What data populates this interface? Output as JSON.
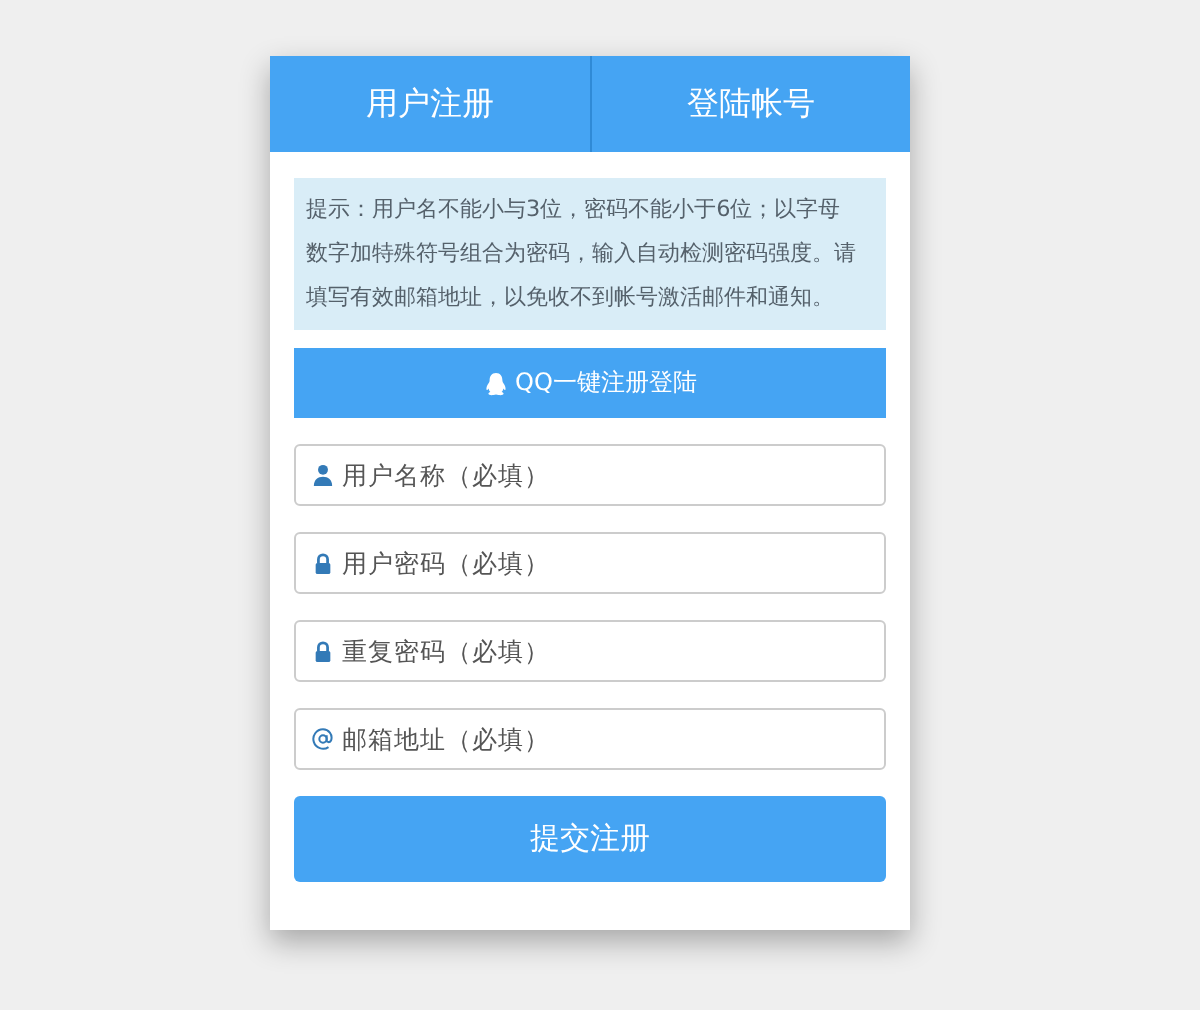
{
  "tabs": [
    {
      "label": "用户注册"
    },
    {
      "label": "登陆帐号"
    }
  ],
  "notice": "提示：用户名不能小与3位，密码不能小于6位；以字母数字加特殊符号组合为密码，输入自动检测密码强度。请填写有效邮箱地址，以免收不到帐号激活邮件和通知。",
  "qq_button": "QQ一键注册登陆",
  "fields": [
    {
      "kind": "user",
      "placeholder": "用户名称（必填）"
    },
    {
      "kind": "lock",
      "placeholder": "用户密码（必填）"
    },
    {
      "kind": "lock",
      "placeholder": "重复密码（必填）"
    },
    {
      "kind": "email",
      "placeholder": "邮箱地址（必填）"
    }
  ],
  "submit_button": "提交注册"
}
